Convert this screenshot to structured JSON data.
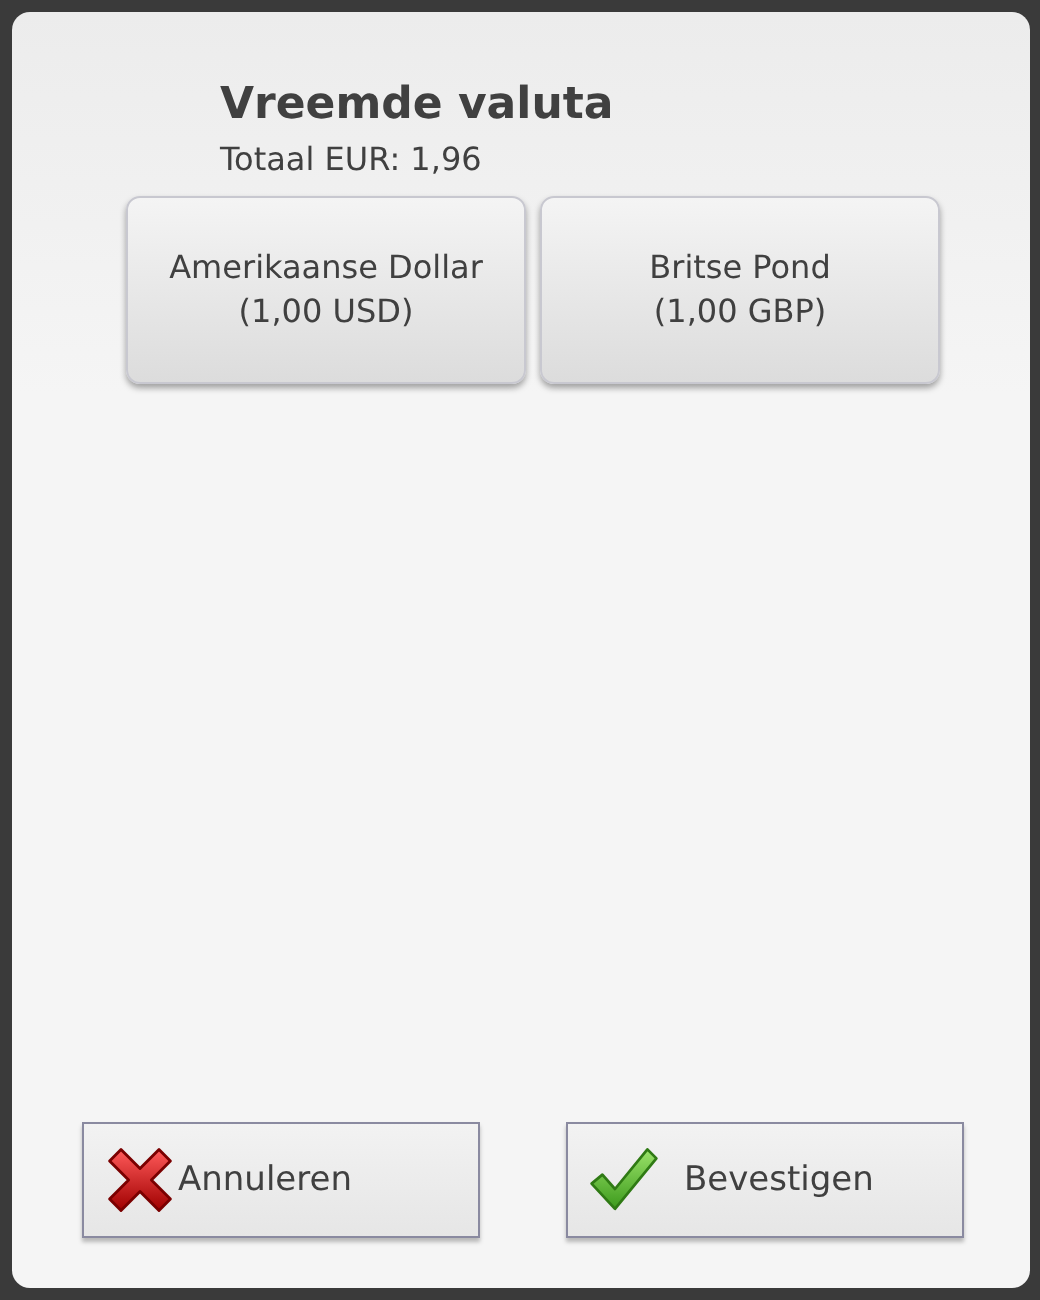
{
  "dialog": {
    "title": "Vreemde valuta",
    "total": "Totaal EUR: 1,96",
    "currencies": [
      {
        "name": "Amerikaanse Dollar",
        "amount": "(1,00 USD)"
      },
      {
        "name": "Britse Pond",
        "amount": "(1,00 GBP)"
      }
    ],
    "actions": [
      {
        "kind": "cancel",
        "label": "Annuleren"
      },
      {
        "kind": "confirm",
        "label": "Bevestigen"
      }
    ]
  }
}
